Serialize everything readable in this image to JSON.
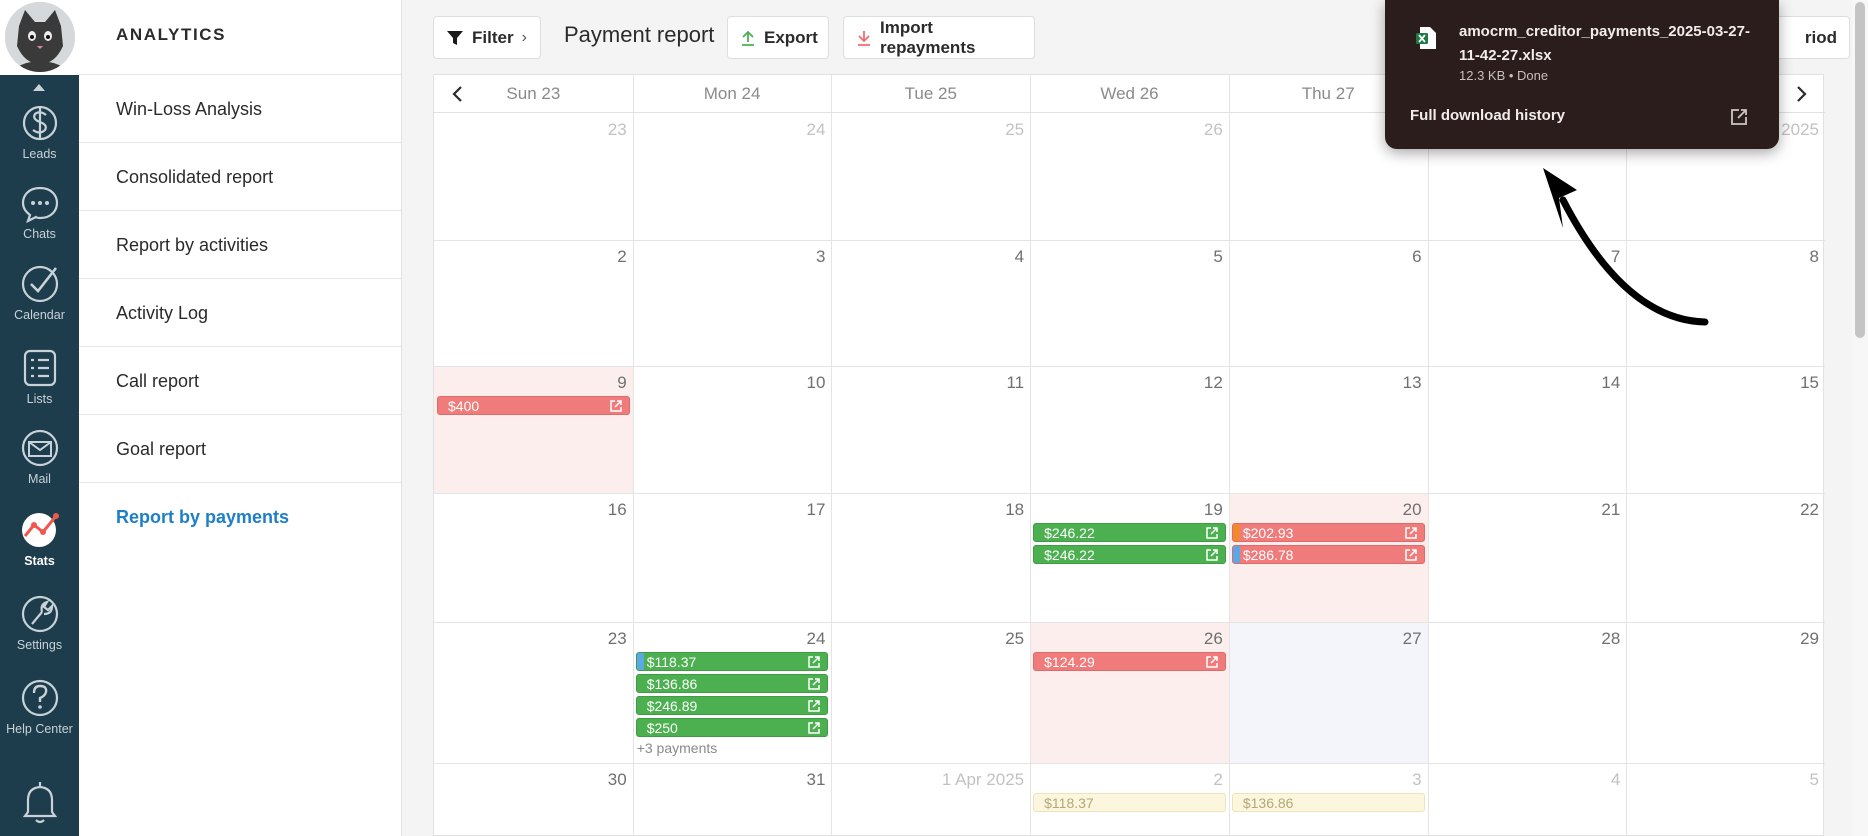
{
  "rail": {
    "items": [
      {
        "label": "Leads",
        "icon": "dollar-icon"
      },
      {
        "label": "Chats",
        "icon": "chat-bubble-icon"
      },
      {
        "label": "Calendar",
        "icon": "checkmark-icon"
      },
      {
        "label": "Lists",
        "icon": "list-icon"
      },
      {
        "label": "Mail",
        "icon": "envelope-icon"
      },
      {
        "label": "Stats",
        "icon": "stats-chart-icon",
        "active": true
      },
      {
        "label": "Settings",
        "icon": "wrench-icon"
      },
      {
        "label": "Help Center",
        "icon": "question-icon"
      }
    ]
  },
  "menu": {
    "heading": "ANALYTICS",
    "items": [
      {
        "label": "Win-Loss Analysis"
      },
      {
        "label": "Consolidated report"
      },
      {
        "label": "Report by activities"
      },
      {
        "label": "Activity Log"
      },
      {
        "label": "Call report"
      },
      {
        "label": "Goal report"
      },
      {
        "label": "Report by payments",
        "active": true
      }
    ]
  },
  "toolbar": {
    "filter_label": "Filter",
    "title": "Payment report",
    "export_label": "Export",
    "import_label": "Import repayments",
    "period_label": "riod"
  },
  "calendar": {
    "days_of_week": [
      "Sun 23",
      "Mon 24",
      "Tue 25",
      "Wed 26",
      "Thu 27",
      "",
      ""
    ],
    "weeks": [
      {
        "days": [
          {
            "n": "23",
            "m": true
          },
          {
            "n": "24",
            "m": true
          },
          {
            "n": "25",
            "m": true
          },
          {
            "n": "26",
            "m": true
          },
          {
            "n": "",
            "m": true
          },
          {
            "n": "",
            "m": true
          },
          {
            "n": "2025",
            "m": true
          }
        ]
      },
      {
        "days": [
          {
            "n": "2"
          },
          {
            "n": "3"
          },
          {
            "n": "4"
          },
          {
            "n": "5"
          },
          {
            "n": "6"
          },
          {
            "n": "7"
          },
          {
            "n": "8"
          }
        ]
      },
      {
        "days": [
          {
            "n": "9"
          },
          {
            "n": "10"
          },
          {
            "n": "11"
          },
          {
            "n": "12"
          },
          {
            "n": "13"
          },
          {
            "n": "14"
          },
          {
            "n": "15"
          }
        ]
      },
      {
        "days": [
          {
            "n": "16"
          },
          {
            "n": "17"
          },
          {
            "n": "18"
          },
          {
            "n": "19"
          },
          {
            "n": "20"
          },
          {
            "n": "21"
          },
          {
            "n": "22"
          }
        ]
      },
      {
        "days": [
          {
            "n": "23"
          },
          {
            "n": "24"
          },
          {
            "n": "25"
          },
          {
            "n": "26"
          },
          {
            "n": "27"
          },
          {
            "n": "28"
          },
          {
            "n": "29"
          }
        ]
      },
      {
        "days": [
          {
            "n": "30"
          },
          {
            "n": "31"
          },
          {
            "n": "1 Apr 2025",
            "m": true
          },
          {
            "n": "2",
            "m": true
          },
          {
            "n": "3",
            "m": true
          },
          {
            "n": "4",
            "m": true
          },
          {
            "n": "5",
            "m": true
          }
        ]
      }
    ],
    "payments": [
      {
        "week": 2,
        "day": 0,
        "slot": 0,
        "amount": "$400",
        "color": "red"
      },
      {
        "week": 3,
        "day": 3,
        "slot": 0,
        "amount": "$246.22",
        "color": "green"
      },
      {
        "week": 3,
        "day": 3,
        "slot": 1,
        "amount": "$246.22",
        "color": "green"
      },
      {
        "week": 3,
        "day": 4,
        "slot": 0,
        "amount": "$202.93",
        "color": "red",
        "strip": "#f08a2c"
      },
      {
        "week": 3,
        "day": 4,
        "slot": 1,
        "amount": "$286.78",
        "color": "red",
        "strip": "#5aa9e6"
      },
      {
        "week": 4,
        "day": 1,
        "slot": 0,
        "amount": "$118.37",
        "color": "green",
        "strip": "#5aa9e6"
      },
      {
        "week": 4,
        "day": 1,
        "slot": 1,
        "amount": "$136.86",
        "color": "green"
      },
      {
        "week": 4,
        "day": 1,
        "slot": 2,
        "amount": "$246.89",
        "color": "green"
      },
      {
        "week": 4,
        "day": 1,
        "slot": 3,
        "amount": "$250",
        "color": "green"
      },
      {
        "week": 4,
        "day": 3,
        "slot": 0,
        "amount": "$124.29",
        "color": "red"
      },
      {
        "week": 5,
        "day": 3,
        "slot": 0,
        "amount": "$118.37",
        "color": "faint"
      },
      {
        "week": 5,
        "day": 4,
        "slot": 0,
        "amount": "$136.86",
        "color": "faint"
      }
    ],
    "more_payments": "+3 payments",
    "highlight_colors": {
      "pink": "#fdeeee",
      "blue": "#f3f5fb"
    }
  },
  "download": {
    "filename": "amocrm_creditor_payments_2025-03-27-11-42-27.xlsx",
    "meta": "12.3 KB • Done",
    "history_label": "Full download history"
  }
}
